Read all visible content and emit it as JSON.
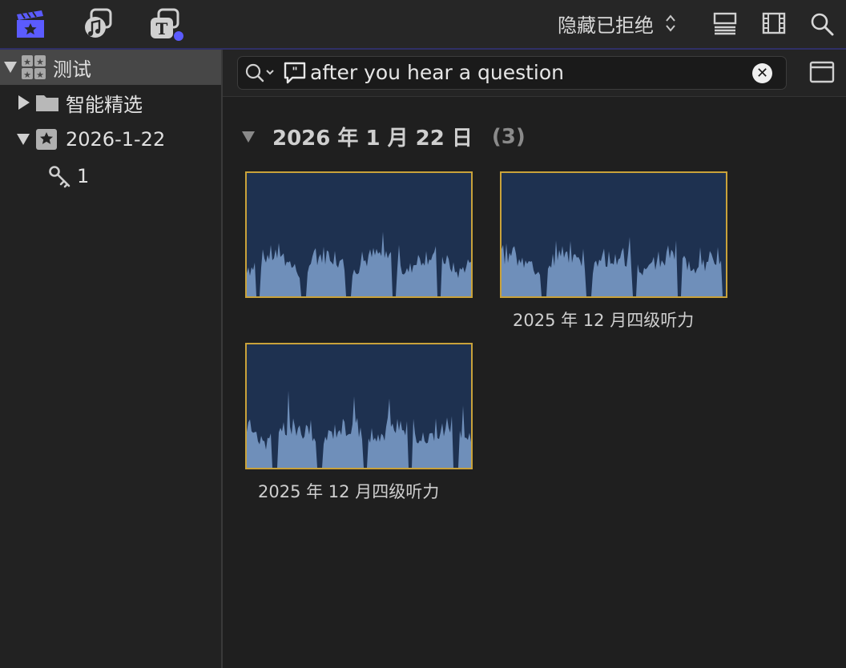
{
  "toolbar": {
    "filter_label": "隐藏已拒绝",
    "icons": [
      "libraries-icon",
      "photos-audio-icon",
      "titles-generators-icon",
      "clip-appearance-icon",
      "filmstrip-icon",
      "search-icon"
    ]
  },
  "sidebar": {
    "items": [
      {
        "label": "测试",
        "icon": "library-icon",
        "expanded": true,
        "selected": true
      },
      {
        "label": "智能精选",
        "icon": "folder-icon",
        "expanded": false
      },
      {
        "label": "2026-1-22",
        "icon": "event-star-icon",
        "expanded": true
      },
      {
        "label": "1",
        "icon": "keyword-icon"
      }
    ]
  },
  "search": {
    "value": "after you hear a question"
  },
  "browser": {
    "group_title": "2026 年 1 月 22 日",
    "group_count": "(3)",
    "clips": [
      {
        "name": ""
      },
      {
        "name": "2025 年 12 月四级听力"
      },
      {
        "name": "2025 年 12 月四级听力"
      }
    ]
  },
  "colors": {
    "accent": "#5b5bff",
    "clip_border": "#c9a23a",
    "clip_bg": "#1e3150",
    "waveform": "#6f8fba"
  }
}
